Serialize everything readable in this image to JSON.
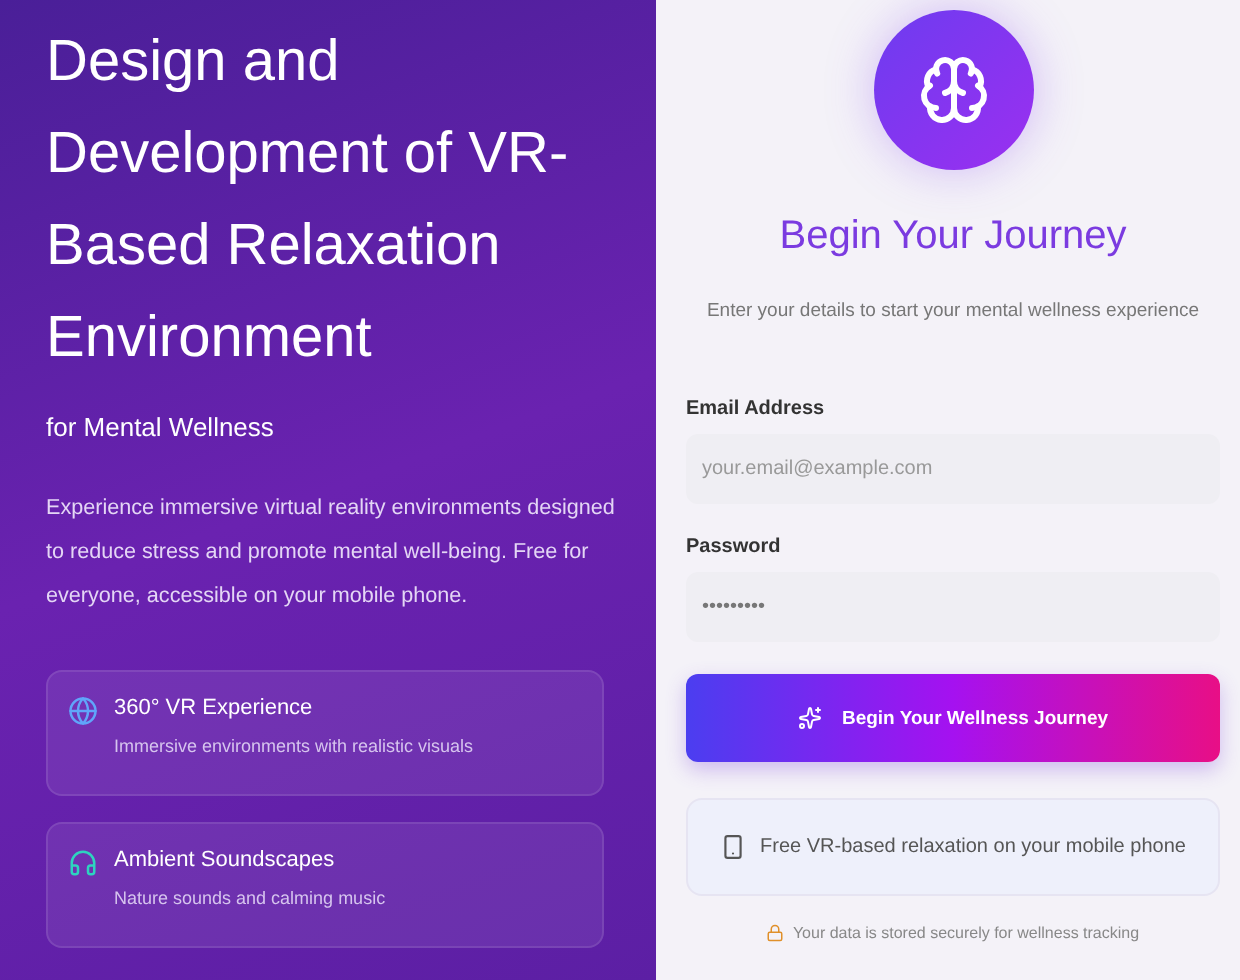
{
  "hero": {
    "title": "Design and\nDevelopment of VR-\nBased Relaxation\nEnvironment",
    "subtitle": "for Mental Wellness",
    "description": "Experience immersive virtual reality environments designed to reduce stress and promote mental well-being. Free for everyone, accessible on your mobile phone.",
    "features": [
      {
        "kind": "globe",
        "title": "360° VR Experience",
        "text": "Immersive environments with realistic visuals"
      },
      {
        "kind": "headphones",
        "title": "Ambient Soundscapes",
        "text": "Nature sounds and calming music"
      }
    ]
  },
  "form": {
    "title": "Begin Your Journey",
    "subtitle": "Enter your details to start your mental wellness experience",
    "fields": [
      {
        "label": "Email Address",
        "placeholder": "your.email@example.com"
      },
      {
        "label": "Password",
        "value": "•••••••••"
      }
    ],
    "submit": "Begin Your Wellness Journey",
    "info": "Free VR-based relaxation on your mobile phone",
    "note": "Your data is stored securely for wellness tracking"
  }
}
